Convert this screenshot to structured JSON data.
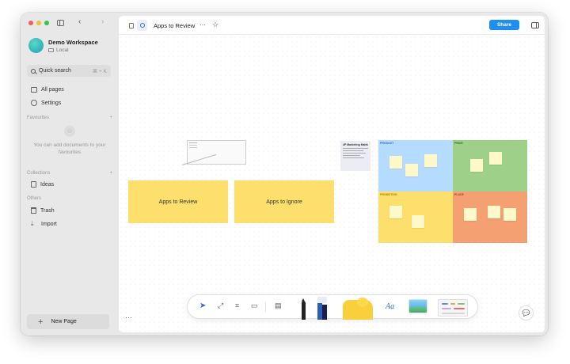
{
  "sidebar": {
    "workspace_name": "Demo Workspace",
    "workspace_type": "Local",
    "quick_search": "Quick search",
    "quick_search_shortcut": "⌘ + K",
    "all_pages": "All pages",
    "settings": "Settings",
    "favourites_label": "Favourites",
    "favourites_empty": "You can add documents to your favourites",
    "collections_label": "Collections",
    "ideas": "Ideas",
    "others_label": "Others",
    "trash": "Trash",
    "import": "Import",
    "new_page": "New Page"
  },
  "topbar": {
    "doc_title": "Apps to Review",
    "share": "Share"
  },
  "canvas": {
    "note_review": "Apps to Review",
    "note_ignore": "Apps to Ignore",
    "text_card_title": "4P Marketing Matrix",
    "quadrants": [
      "PRODUCT",
      "PRICE",
      "PROMOTION",
      "PLACE"
    ]
  },
  "toolbar": {
    "text_tool": "Aa"
  },
  "colors": {
    "accent": "#1e8ef3",
    "note_yellow": "#fcdf6d",
    "q_blue": "#b5dbff",
    "q_green": "#9ed08a",
    "q_orange": "#f4a072"
  }
}
